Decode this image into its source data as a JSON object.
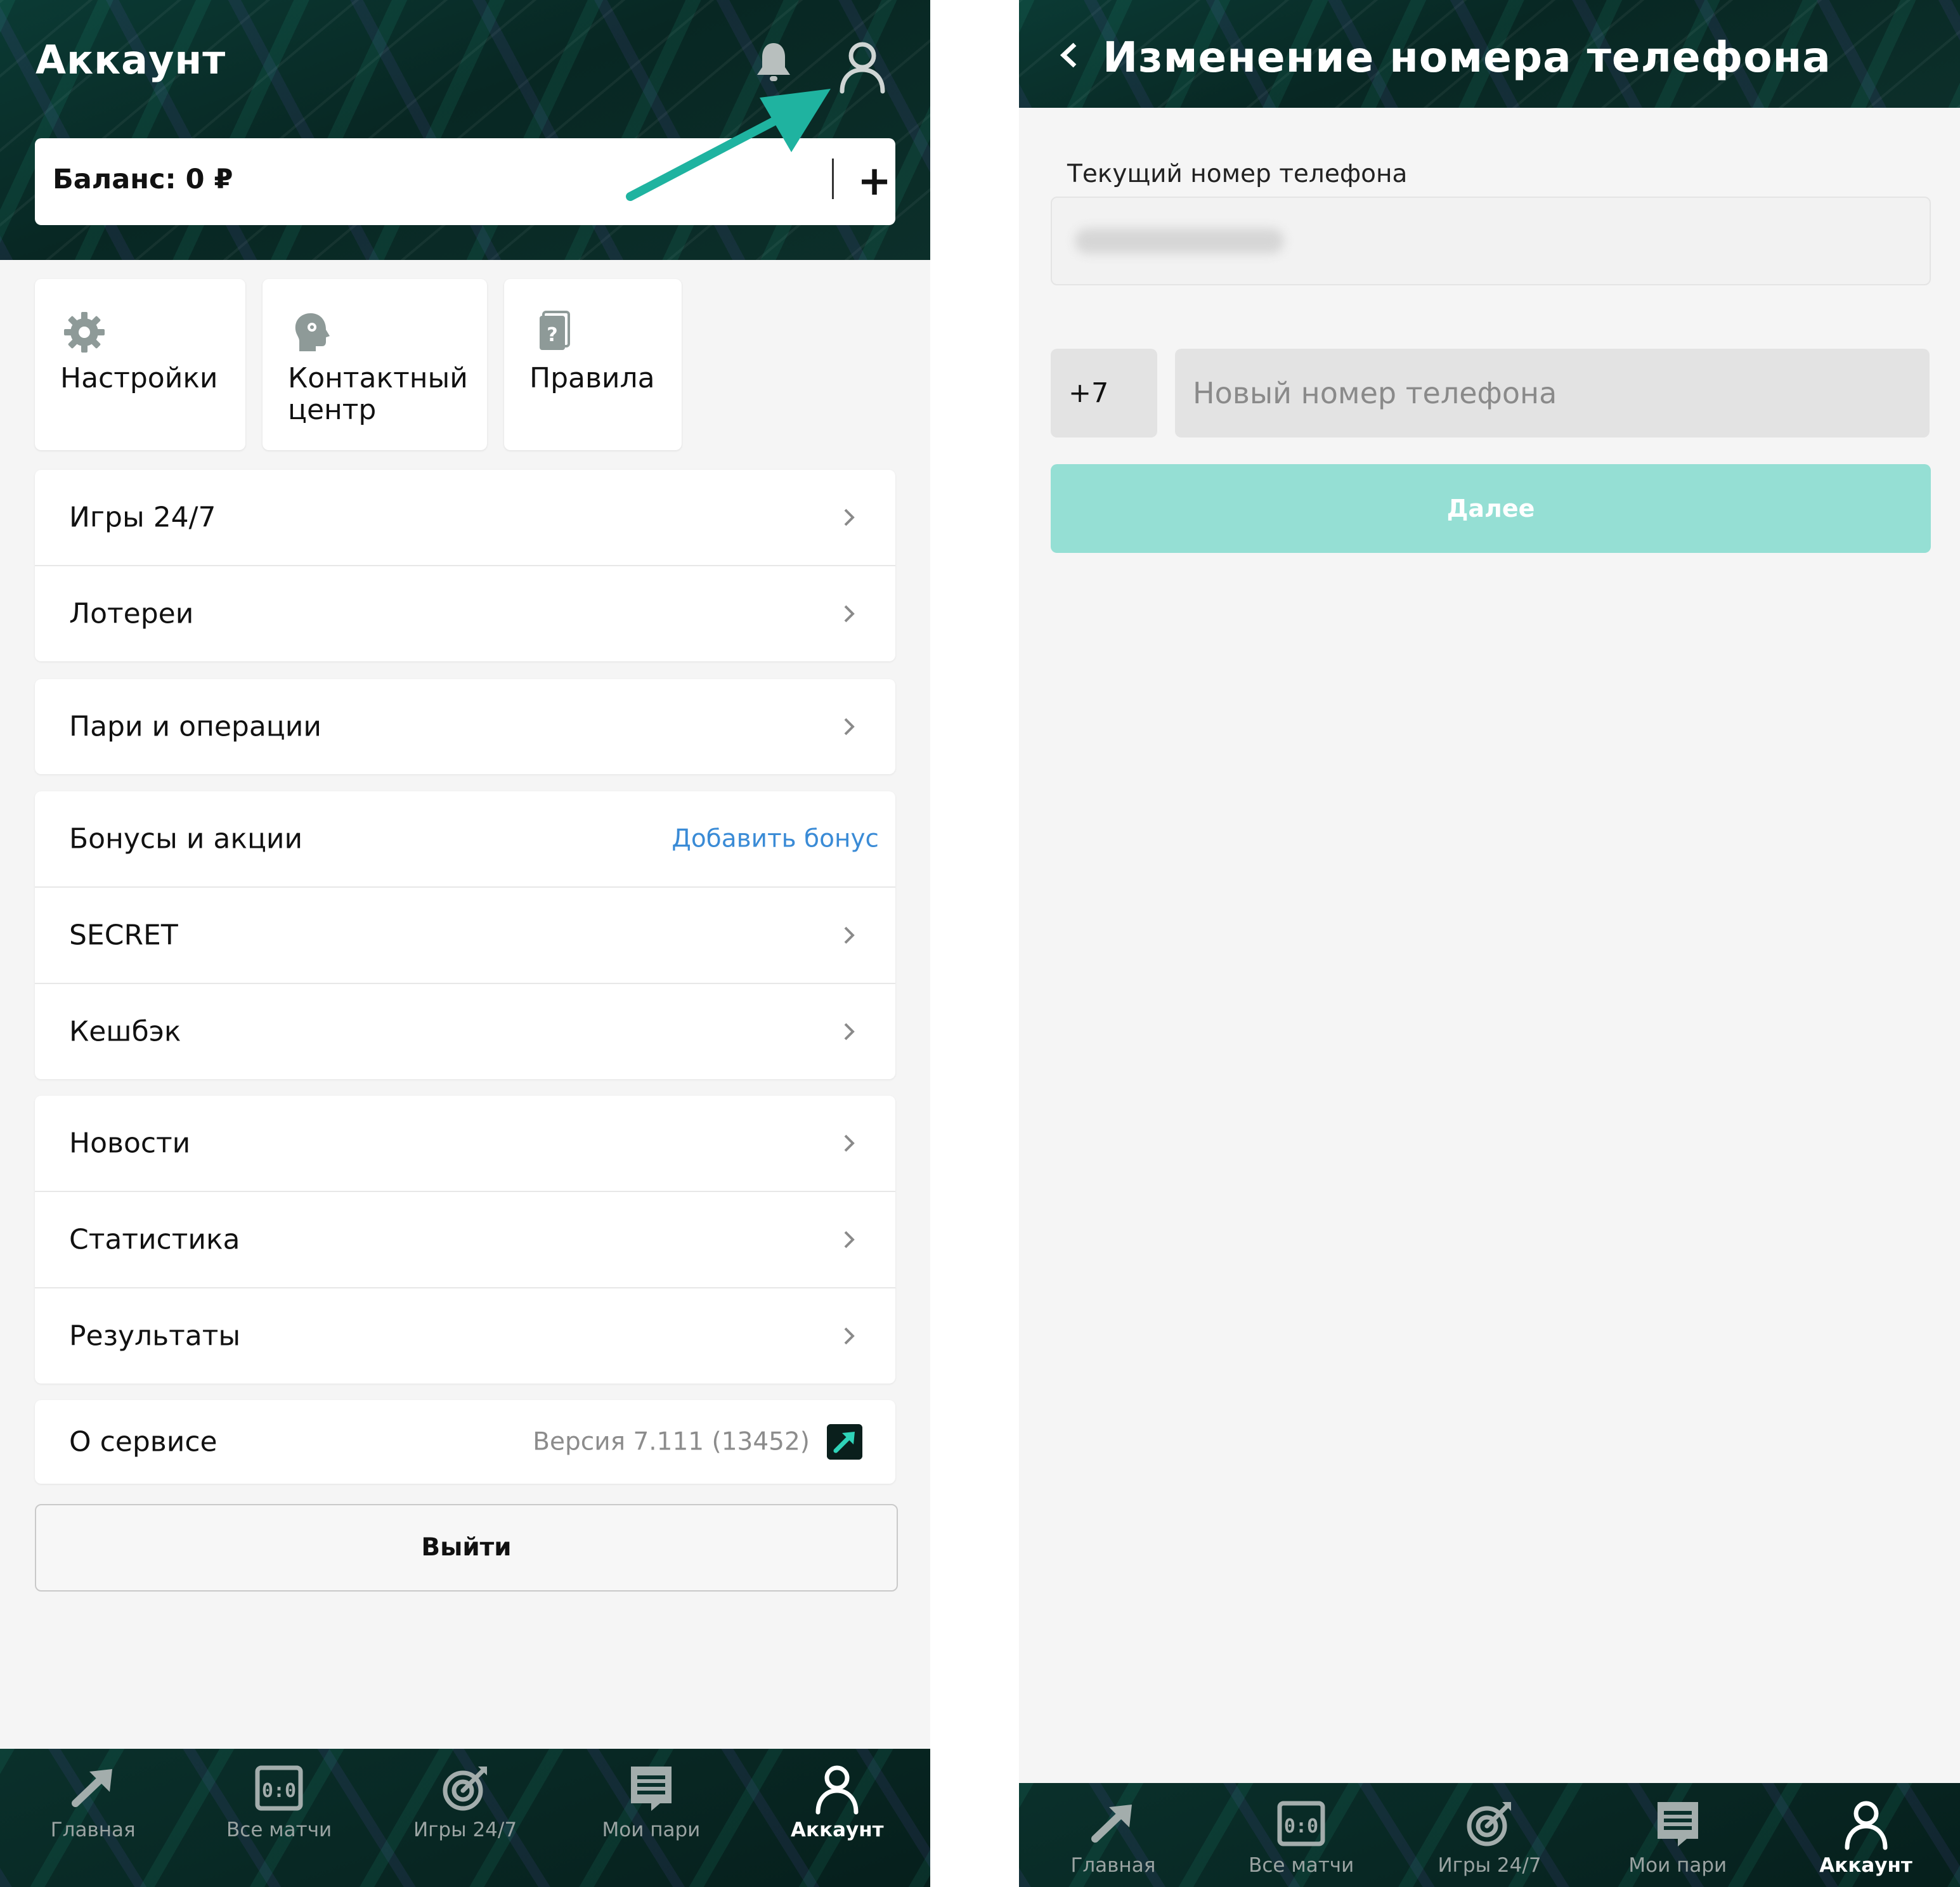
{
  "left": {
    "header": {
      "title": "Аккаунт",
      "balance_text": "Баланс: 0 ₽",
      "add_label": "+"
    },
    "quick_actions": [
      {
        "label": "Настройки",
        "icon": "gear-icon"
      },
      {
        "label": "Контактный центр",
        "icon": "support-head-icon"
      },
      {
        "label": "Правила",
        "icon": "rules-book-icon"
      }
    ],
    "menu": {
      "games": "Игры 24/7",
      "lotteries": "Лотереи",
      "bets": "Пари и операции",
      "bonuses": "Бонусы и акции",
      "add_bonus": "Добавить бонус",
      "secret": "SECRET",
      "cashback": "Кешбэк",
      "news": "Новости",
      "statistics": "Статистика",
      "results": "Результаты",
      "about": "О сервисе",
      "version": "Версия 7.111 (13452)"
    },
    "logout_label": "Выйти"
  },
  "right": {
    "header": {
      "title": "Изменение номера телефона"
    },
    "current_phone_label": "Текущий номер телефона",
    "country_code": "+7",
    "new_phone_placeholder": "Новый номер телефона",
    "next_label": "Далее"
  },
  "tabbar": [
    {
      "label": "Главная",
      "icon": "home-arrow-icon",
      "active": false
    },
    {
      "label": "Все матчи",
      "icon": "scoreboard-icon",
      "active": false
    },
    {
      "label": "Игры 24/7",
      "icon": "target-icon",
      "active": false
    },
    {
      "label": "Мои пари",
      "icon": "bet-slip-icon",
      "active": false
    },
    {
      "label": "Аккаунт",
      "icon": "user-icon",
      "active": true
    }
  ],
  "colors": {
    "header_dark": "#082723",
    "accent_teal": "#1fb3a0",
    "next_button": "#95dfd4",
    "link_blue": "#3a8bd6"
  }
}
